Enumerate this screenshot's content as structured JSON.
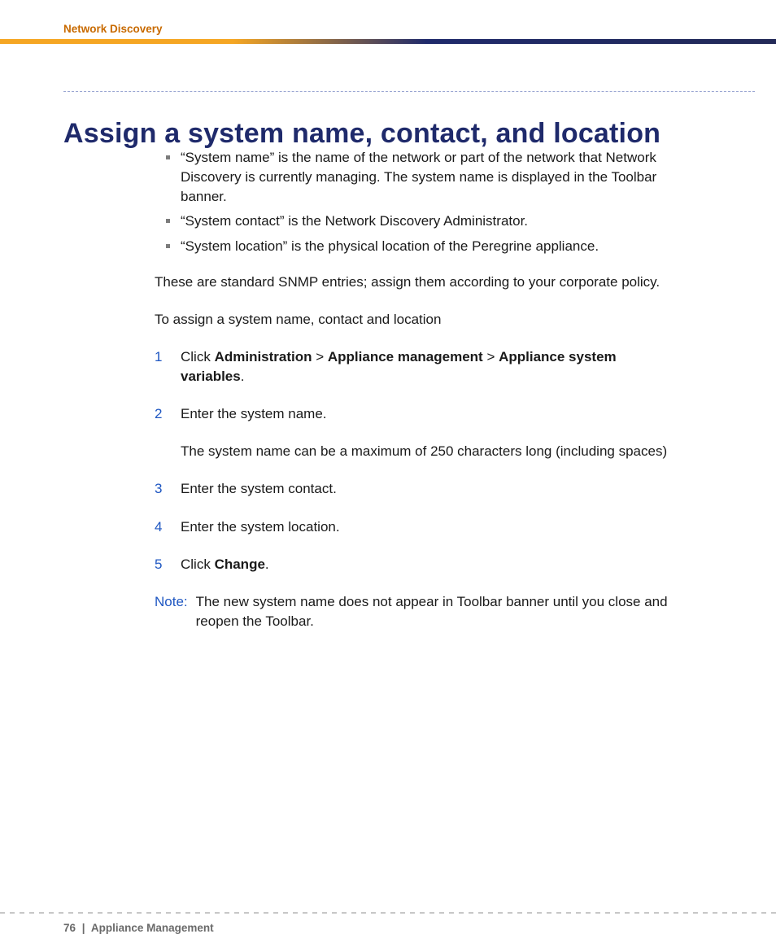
{
  "header": {
    "running_title": "Network Discovery"
  },
  "title": "Assign a system name, contact, and location",
  "bullets": [
    "“System name” is the name of the network or part of the network that Network Discovery is currently managing. The system name is displayed in the Toolbar banner.",
    "“System contact” is the Network Discovery Administrator.",
    "“System location” is the physical location of the Peregrine appliance."
  ],
  "para_intro": "These are standard SNMP entries; assign them according to your corporate policy.",
  "para_lead": "To assign a system name, contact and location",
  "steps": [
    {
      "num": "1",
      "pre": "Click ",
      "bold1": "Administration",
      "sep1": " > ",
      "bold2": "Appliance management",
      "sep2": " > ",
      "bold3": "Appliance system variables",
      "post": ".",
      "sub": ""
    },
    {
      "num": "2",
      "text": "Enter the system name.",
      "sub": "The system name can be a maximum of 250 characters long (including spaces)"
    },
    {
      "num": "3",
      "text": "Enter the system contact."
    },
    {
      "num": "4",
      "text": "Enter the system location."
    },
    {
      "num": "5",
      "pre": "Click ",
      "bold1": "Change",
      "post": "."
    }
  ],
  "note": {
    "label": "Note:",
    "text": "The new system name does not appear in Toolbar banner until you close and reopen the Toolbar."
  },
  "footer": {
    "page": "76",
    "sep": "|",
    "section": "Appliance Management"
  }
}
